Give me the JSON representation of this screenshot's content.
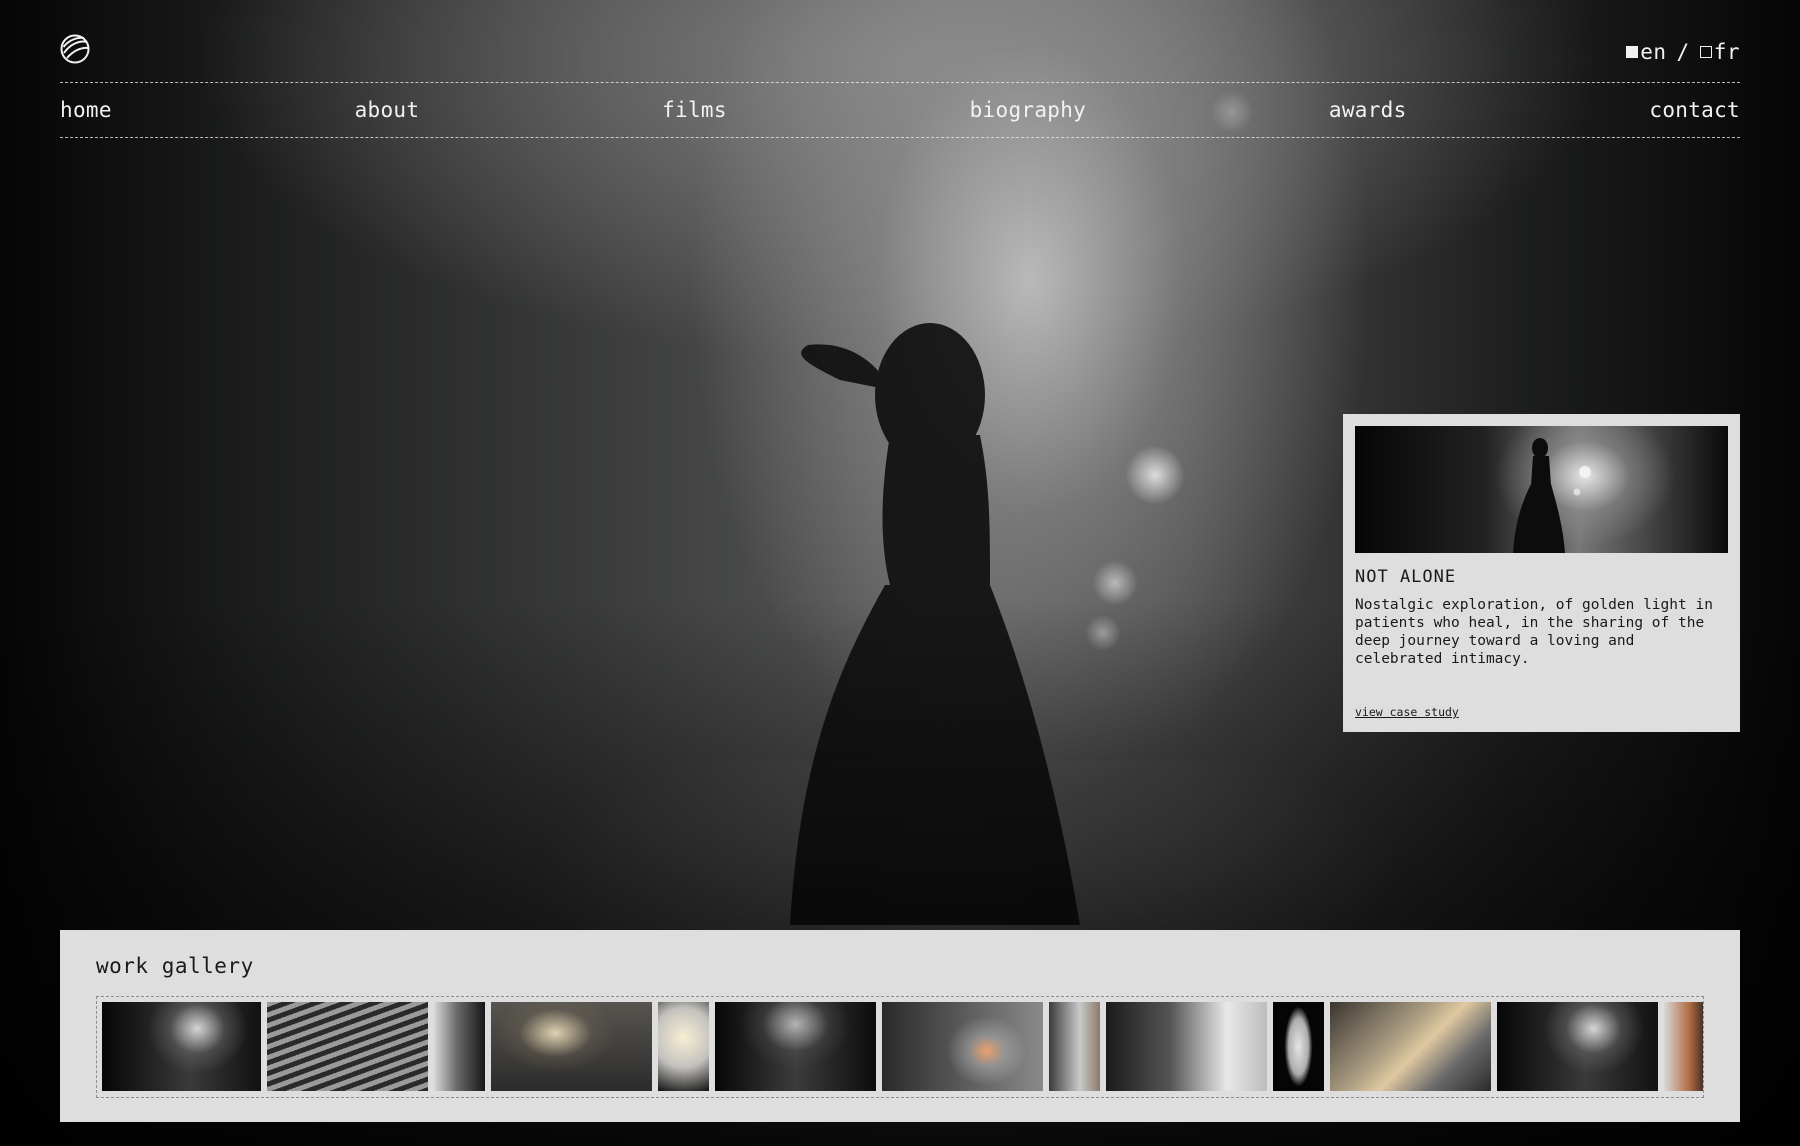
{
  "header": {
    "logo_icon": "globe-logo-icon",
    "languages": [
      {
        "code": "en",
        "active": true
      },
      {
        "code": "fr",
        "active": false
      }
    ],
    "lang_separator": "/"
  },
  "nav": {
    "items": [
      {
        "label": "home"
      },
      {
        "label": "about"
      },
      {
        "label": "films"
      },
      {
        "label": "biography"
      },
      {
        "label": "awards"
      },
      {
        "label": "contact"
      }
    ]
  },
  "feature": {
    "title": "NOT ALONE",
    "description": "Nostalgic exploration, of golden light in patients who heal, in the sharing of the deep journey toward a loving and celebrated intimacy.",
    "link_label": "view case study"
  },
  "gallery": {
    "title": "work gallery",
    "tiles": [
      {
        "w": 159,
        "tone": "alley-dark"
      },
      {
        "w": 161,
        "tone": "blinds"
      },
      {
        "w": 51,
        "tone": "portrait-light"
      },
      {
        "w": 161,
        "tone": "golden"
      },
      {
        "w": 51,
        "tone": "sparkle"
      },
      {
        "w": 161,
        "tone": "alley-dress"
      },
      {
        "w": 161,
        "tone": "face-fire"
      },
      {
        "w": 51,
        "tone": "face-crop"
      },
      {
        "w": 161,
        "tone": "window"
      },
      {
        "w": 51,
        "tone": "smoke"
      },
      {
        "w": 161,
        "tone": "rock-light"
      },
      {
        "w": 161,
        "tone": "alley-dark"
      },
      {
        "w": 43,
        "tone": "flame"
      }
    ]
  },
  "colors": {
    "panel": "#dedede",
    "text_dark": "#1a1a1a",
    "text_light": "#f2f2f2"
  }
}
